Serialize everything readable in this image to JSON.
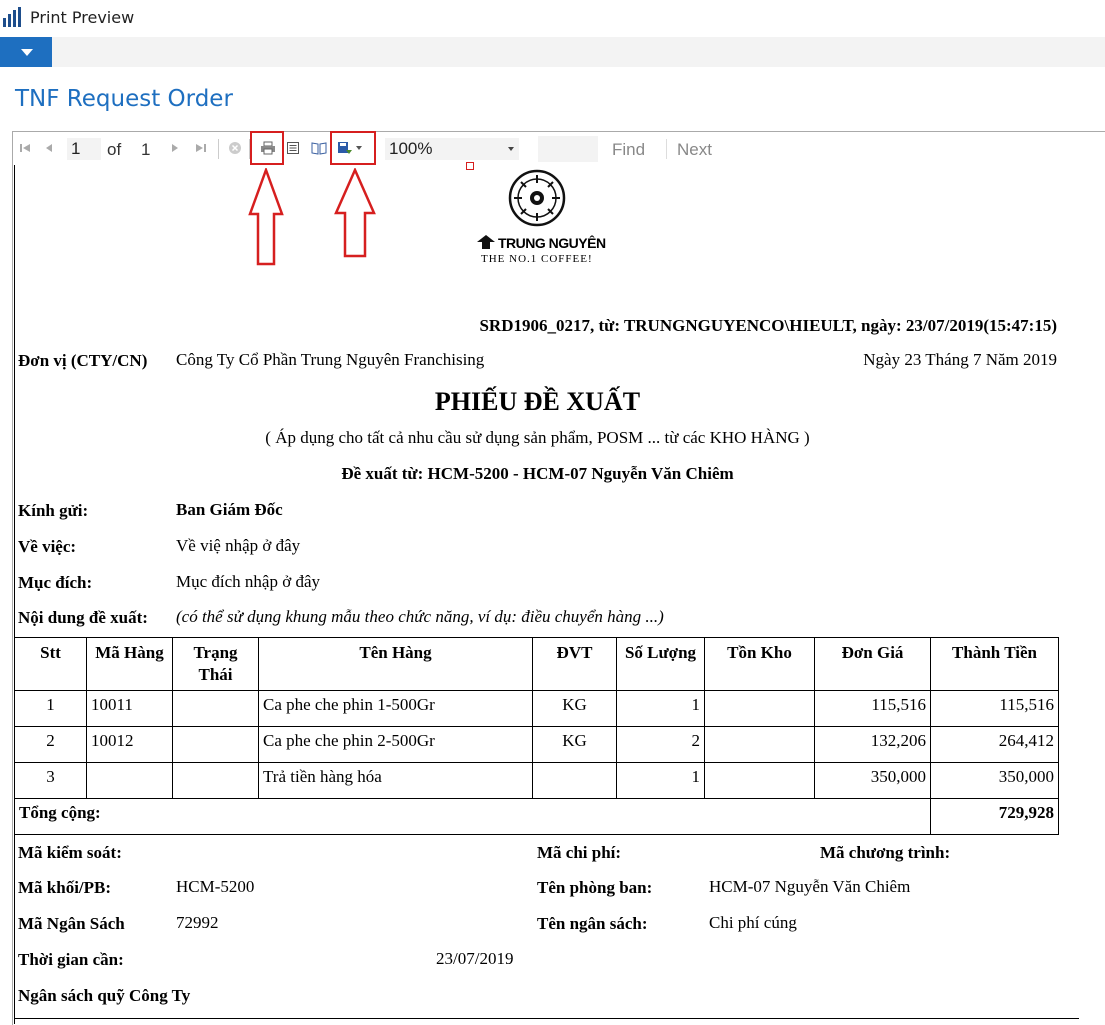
{
  "window": {
    "title": "Print Preview"
  },
  "page": {
    "title": "TNF Request Order"
  },
  "toolbar": {
    "page_current": "1",
    "page_of": "of",
    "page_total": "1",
    "zoom": "100%",
    "find_label": "Find",
    "next_label": "Next"
  },
  "logo": {
    "brand": "TRUNG NGUYÊN",
    "tagline": "THE NO.1 COFFEE!"
  },
  "report": {
    "reference": "SRD1906_0217, từ: TRUNGNGUYENCO\\HIEULT, ngày: 23/07/2019(15:47:15)",
    "unit_label": "Đơn vị (CTY/CN)",
    "unit_value": "Công Ty Cổ Phần Trung Nguyên Franchising",
    "date_text": "Ngày 23 Tháng 7 Năm 2019",
    "heading": "PHIẾU ĐỀ XUẤT",
    "subheading": "( Áp dụng cho tất cả nhu cầu sử dụng sản phẩm, POSM ... từ các KHO HÀNG )",
    "proposer": "Đề xuất từ: HCM-5200 - HCM-07 Nguyễn Văn Chiêm",
    "to_label": "Kính gửi:",
    "to_value": "Ban Giám Đốc",
    "subject_label": "Về việc:",
    "subject_value": "Về việ nhập ở đây",
    "purpose_label": "Mục đích:",
    "purpose_value": "Mục đích nhập ở đây",
    "content_label": "Nội dung đề xuất:",
    "content_value": "(có thể sử dụng khung mẫu theo chức năng, ví dụ: điều chuyển hàng ...)"
  },
  "table": {
    "headers": [
      "Stt",
      "Mã Hàng",
      "Trạng Thái",
      "Tên Hàng",
      "ĐVT",
      "Số Lượng",
      "Tồn Kho",
      "Đơn Giá",
      "Thành Tiền"
    ],
    "rows": [
      [
        "1",
        "10011",
        "",
        "Ca phe che phin 1-500Gr",
        "KG",
        "1",
        "",
        "115,516",
        "115,516"
      ],
      [
        "2",
        "10012",
        "",
        "Ca phe che phin 2-500Gr",
        "KG",
        "2",
        "",
        "132,206",
        "264,412"
      ],
      [
        "3",
        "",
        "",
        "Trả tiền hàng hóa",
        "",
        "1",
        "",
        "350,000",
        "350,000"
      ]
    ],
    "total_label": "Tổng cộng:",
    "total_value": "729,928"
  },
  "footer": {
    "control_label": "Mã kiểm soát:",
    "cost_label": "Mã chi phí:",
    "program_label": "Mã chương trình:",
    "dept_code_label": "Mã khối/PB:",
    "dept_code_value": "HCM-5200",
    "dept_name_label": "Tên phòng ban:",
    "dept_name_value": "HCM-07 Nguyễn Văn Chiêm",
    "budget_code_label": "Mã Ngân Sách",
    "budget_code_value": "72992",
    "budget_name_label": "Tên ngân sách:",
    "budget_name_value": "Chi phí cúng",
    "time_label": "Thời gian cần:",
    "time_value": "23/07/2019",
    "fund_label": "Ngân sách quỹ Công Ty"
  },
  "colors": {
    "accent": "#1e6fc0",
    "highlight": "#d61f1f"
  }
}
